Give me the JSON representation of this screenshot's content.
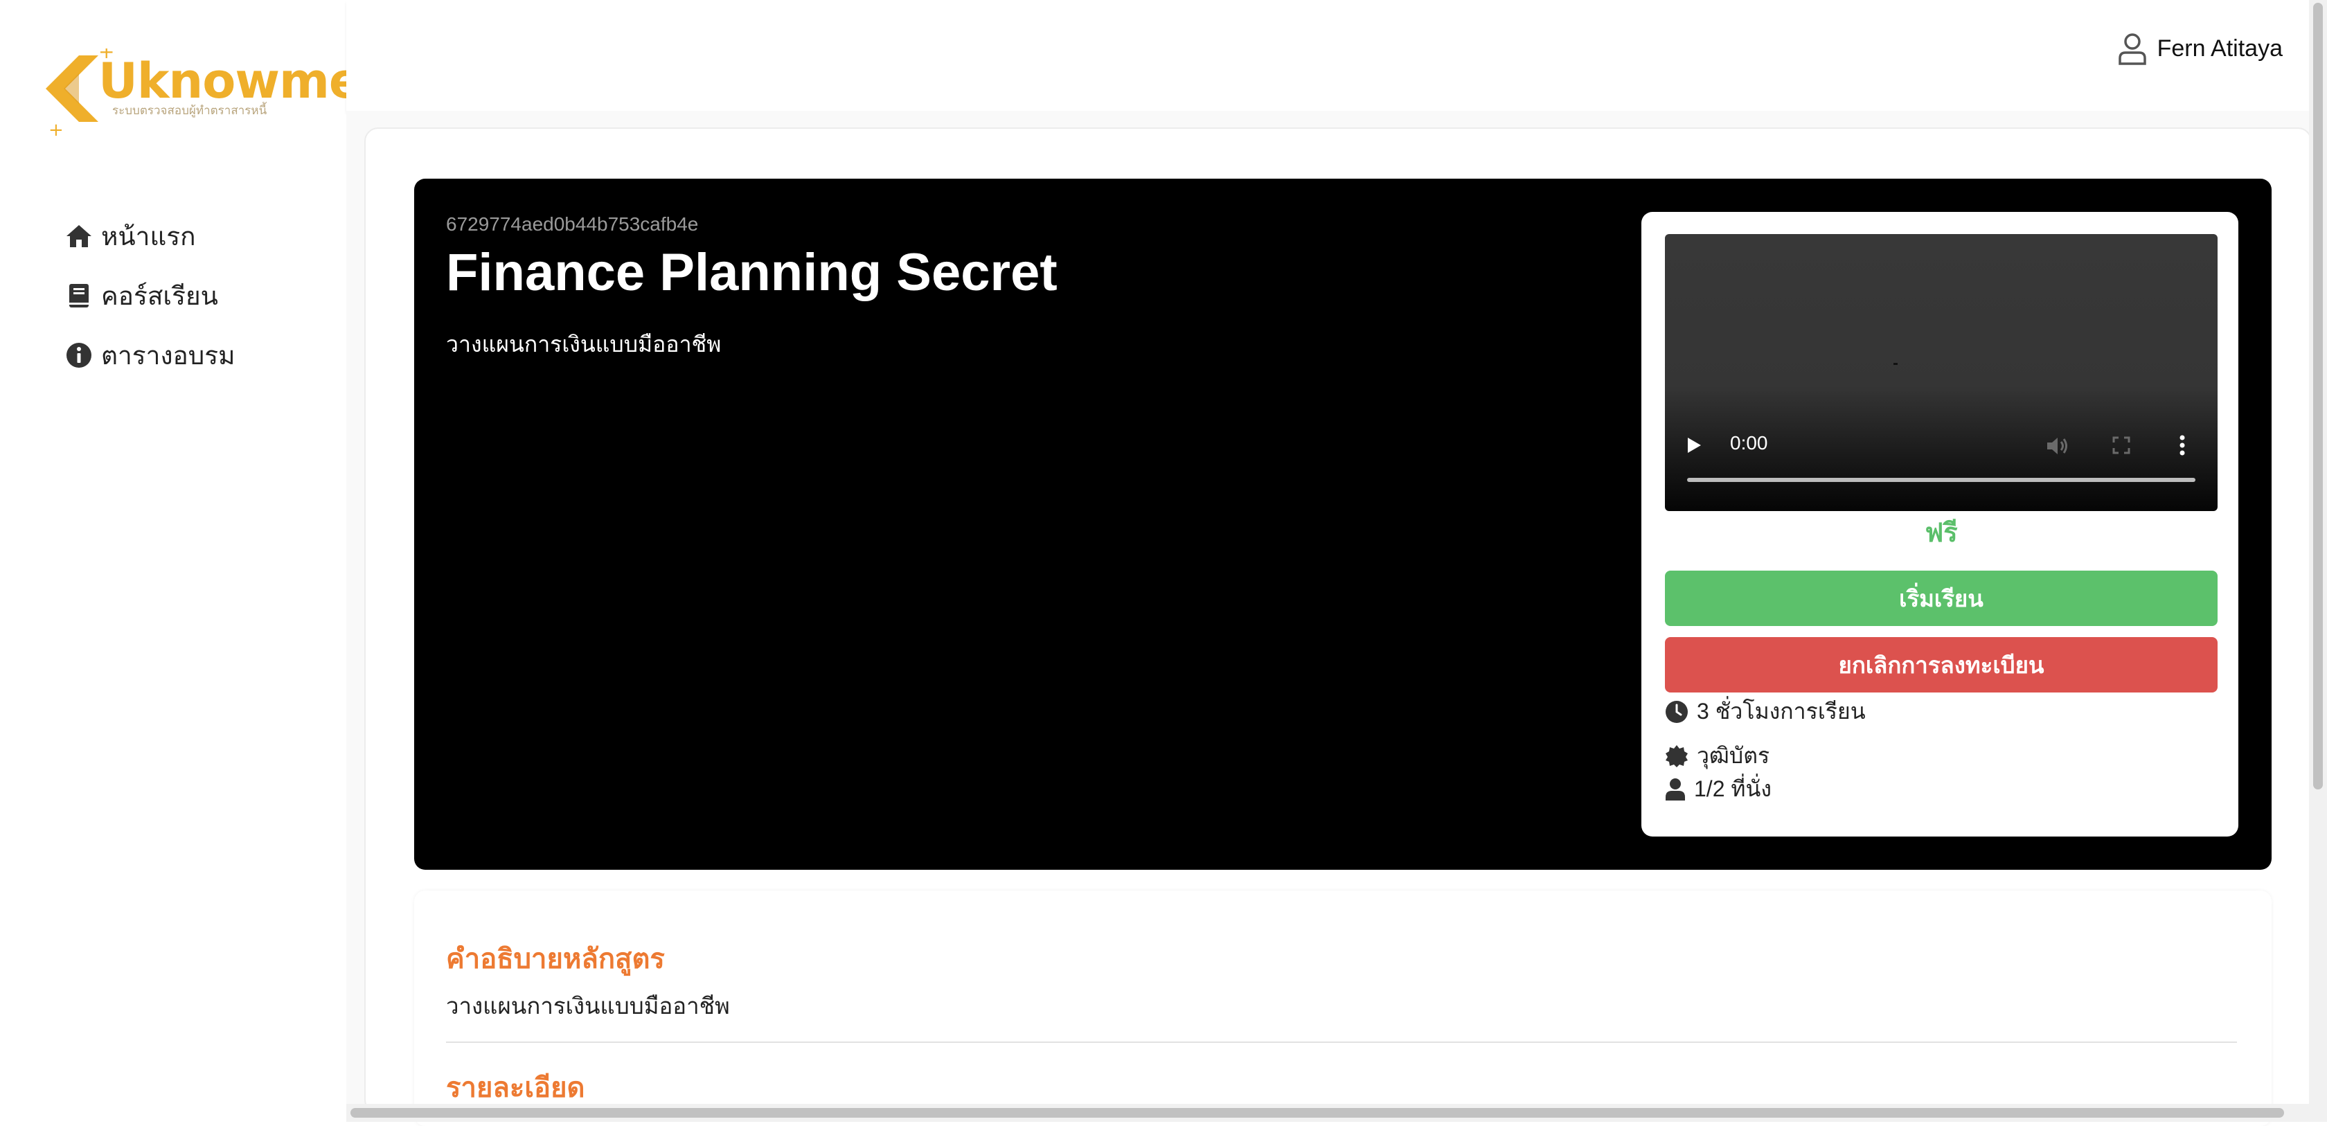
{
  "brand": {
    "name": "Uknowme",
    "tagline": "ระบบตรวจสอบผู้ทำตราสารหนี้",
    "color": "#efaf2b"
  },
  "sidebar": {
    "items": [
      {
        "label": "หน้าแรก",
        "icon": "home-icon"
      },
      {
        "label": "คอร์สเรียน",
        "icon": "book-icon"
      },
      {
        "label": "ตารางอบรม",
        "icon": "info-circle-icon"
      }
    ]
  },
  "header": {
    "user_name": "Fern Atitaya",
    "user_icon": "user-icon"
  },
  "course": {
    "id": "6729774aed0b44b753cafb4e",
    "title": "Finance Planning Secret",
    "short_description": "วางแผนการเงินแบบมืออาชีพ",
    "video": {
      "time": "0:00"
    },
    "price": "ฟรี",
    "start_button": "เริ่มเรียน",
    "cancel_button": "ยกเลิกการลงทะเบียน",
    "hours": "3 ชั่วโมงการเรียน",
    "certificate": "วุฒิบัตร",
    "seats": "1/2 ที่นั่ง"
  },
  "description": {
    "heading": "คำอธิบายหลักสูตร",
    "text": "วางแผนการเงินแบบมืออาชีพ",
    "details_heading": "รายละเอียด"
  },
  "colors": {
    "accent_orange": "#ed7a32",
    "success_green": "#5cc16b",
    "danger_red": "#dc524e",
    "hero_bg": "#000000"
  }
}
